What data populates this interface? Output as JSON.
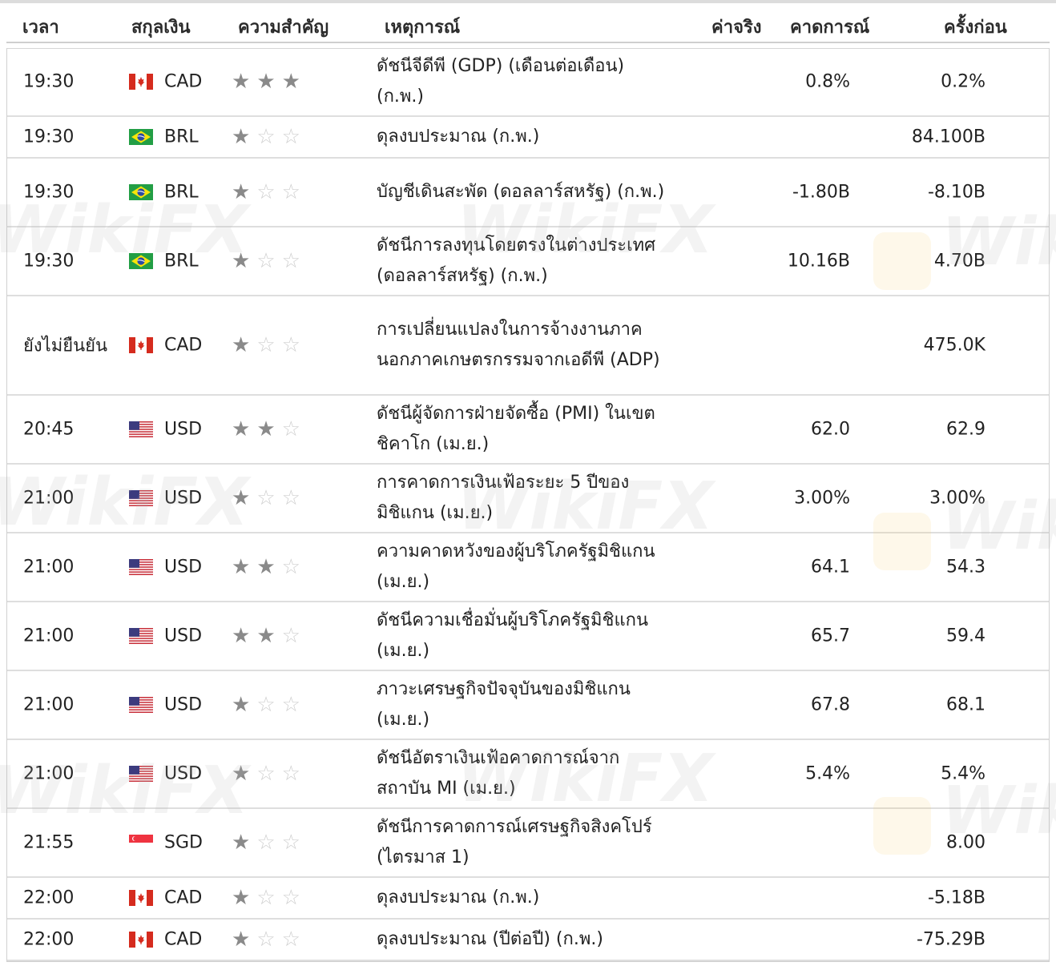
{
  "headers": {
    "time": "เวลา",
    "currency": "สกุลเงิน",
    "importance": "ความสำคัญ",
    "event": "เหตุการณ์",
    "actual": "ค่าจริง",
    "forecast": "คาดการณ์",
    "previous": "ครั้งก่อน"
  },
  "watermark": "WikiFX",
  "rows": [
    {
      "time": "19:30",
      "flag": "canada-flag-icon",
      "currency": "CAD",
      "stars": 3,
      "event": "ดัชนีจีดีพี (GDP) (เดือนต่อเดือน) (ก.พ.)",
      "forecast": "0.8%",
      "previous": "0.2%"
    },
    {
      "time": "19:30",
      "flag": "brazil-flag-icon",
      "currency": "BRL",
      "stars": 1,
      "event": "ดุลงบประมาณ (ก.พ.)",
      "forecast": "",
      "previous": "84.100B"
    },
    {
      "time": "19:30",
      "flag": "brazil-flag-icon",
      "currency": "BRL",
      "stars": 1,
      "event": "บัญชีเดินสะพัด (ดอลลาร์สหรัฐ) (ก.พ.)",
      "forecast": "-1.80B",
      "previous": "-8.10B"
    },
    {
      "time": "19:30",
      "flag": "brazil-flag-icon",
      "currency": "BRL",
      "stars": 1,
      "event": "ดัชนีการลงทุนโดยตรงในต่างประเทศ (ดอลลาร์สหรัฐ) (ก.พ.)",
      "forecast": "10.16B",
      "previous": "4.70B"
    },
    {
      "time": "ยังไม่ยืนยัน",
      "flag": "canada-flag-icon",
      "currency": "CAD",
      "stars": 1,
      "event": "การเปลี่ยนแปลงในการจ้างงานภาคนอกภาคเกษตรกรรมจากเอดีพี (ADP)",
      "forecast": "",
      "previous": "475.0K"
    },
    {
      "time": "20:45",
      "flag": "usa-flag-icon",
      "currency": "USD",
      "stars": 2,
      "event": "ดัชนีผู้จัดการฝ่ายจัดซื้อ (PMI) ในเขตชิคาโก (เม.ย.)",
      "forecast": "62.0",
      "previous": "62.9"
    },
    {
      "time": "21:00",
      "flag": "usa-flag-icon",
      "currency": "USD",
      "stars": 1,
      "event": "การคาดการเงินเฟ้อระยะ 5 ปีของมิชิแกน (เม.ย.)",
      "forecast": "3.00%",
      "previous": "3.00%"
    },
    {
      "time": "21:00",
      "flag": "usa-flag-icon",
      "currency": "USD",
      "stars": 2,
      "event": "ความคาดหวังของผู้บริโภครัฐมิชิแกน (เม.ย.)",
      "forecast": "64.1",
      "previous": "54.3"
    },
    {
      "time": "21:00",
      "flag": "usa-flag-icon",
      "currency": "USD",
      "stars": 2,
      "event": "ดัชนีความเชื่อมั่นผู้บริโภครัฐมิชิแกน (เม.ย.)",
      "forecast": "65.7",
      "previous": "59.4"
    },
    {
      "time": "21:00",
      "flag": "usa-flag-icon",
      "currency": "USD",
      "stars": 1,
      "event": "ภาวะเศรษฐกิจปัจจุบันของมิชิแกน (เม.ย.)",
      "forecast": "67.8",
      "previous": "68.1"
    },
    {
      "time": "21:00",
      "flag": "usa-flag-icon",
      "currency": "USD",
      "stars": 1,
      "event": "ดัชนีอัตราเงินเฟ้อคาดการณ์จากสถาบัน MI (เม.ย.)",
      "forecast": "5.4%",
      "previous": "5.4%"
    },
    {
      "time": "21:55",
      "flag": "singapore-flag-icon",
      "currency": "SGD",
      "stars": 1,
      "event": "ดัชนีการคาดการณ์เศรษฐกิจสิงคโปร์ (ไตรมาส 1)",
      "forecast": "",
      "previous": "8.00"
    },
    {
      "time": "22:00",
      "flag": "canada-flag-icon",
      "currency": "CAD",
      "stars": 1,
      "event": "ดุลงบประมาณ (ก.พ.)",
      "forecast": "",
      "previous": "-5.18B"
    },
    {
      "time": "22:00",
      "flag": "canada-flag-icon",
      "currency": "CAD",
      "stars": 1,
      "event": "ดุลงบประมาณ (ปีต่อปี) (ก.พ.)",
      "forecast": "",
      "previous": "-75.29B"
    }
  ]
}
